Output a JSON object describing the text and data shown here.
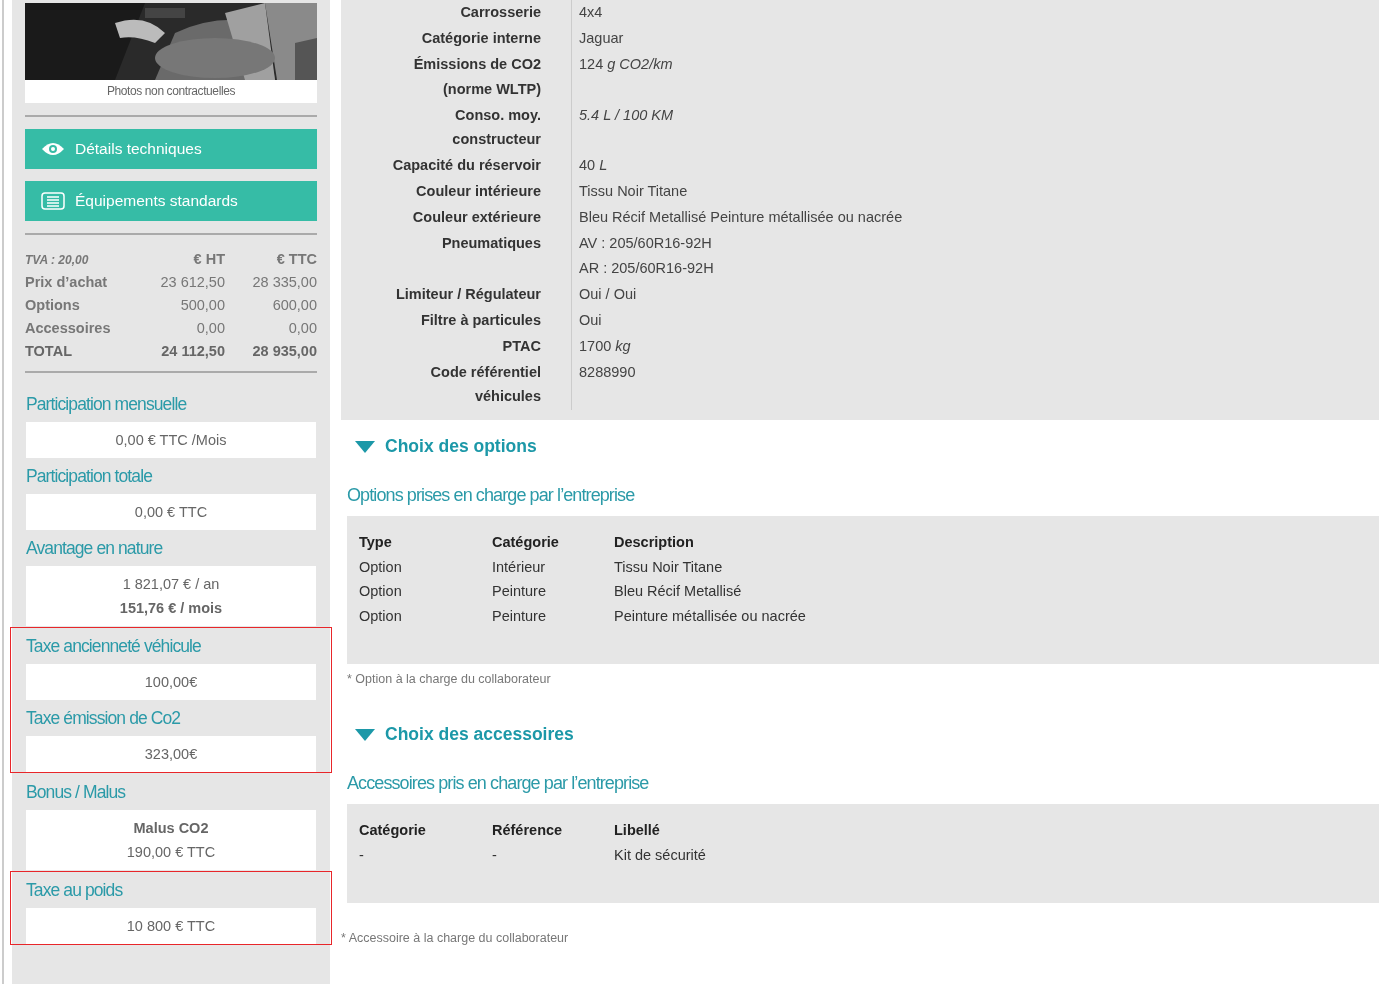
{
  "photo": {
    "kind": "picture",
    "caption": "Photos non contractuelles"
  },
  "actions": [
    {
      "label": "Détails techniques"
    },
    {
      "label": "Équipements standards"
    }
  ],
  "prices": {
    "columns": [
      "TVA : 20,00",
      "€ HT",
      "€ TTC"
    ],
    "rows": [
      {
        "label": "Prix d’achat",
        "ht": "23 612,50",
        "ttc": "28 335,00",
        "total": false
      },
      {
        "label": "Options",
        "ht": "500,00",
        "ttc": "600,00",
        "total": false
      },
      {
        "label": "Accessoires",
        "ht": "0,00",
        "ttc": "0,00",
        "total": false
      },
      {
        "label": "TOTAL",
        "ht": "24 112,50",
        "ttc": "28 935,00",
        "total": true
      }
    ]
  },
  "summary_groups": [
    {
      "highlighted": false,
      "items": [
        {
          "title": "Participation mensuelle",
          "lines": [
            {
              "text": "0,00 € TTC /Mois",
              "bold": false
            }
          ]
        },
        {
          "title": "Participation totale",
          "lines": [
            {
              "text": "0,00 € TTC",
              "bold": false
            }
          ]
        },
        {
          "title": "Avantage en nature",
          "lines": [
            {
              "text": "1 821,07 € / an",
              "bold": false
            },
            {
              "text": "151,76 € / mois",
              "bold": true
            }
          ]
        }
      ]
    },
    {
      "highlighted": true,
      "items": [
        {
          "title": "Taxe ancienneté véhicule",
          "lines": [
            {
              "text": "100,00€",
              "bold": false
            }
          ]
        },
        {
          "title": "Taxe émission de Co2",
          "lines": [
            {
              "text": "323,00€",
              "bold": false
            }
          ]
        }
      ]
    },
    {
      "highlighted": false,
      "items": [
        {
          "title": "Bonus / Malus",
          "lines": [
            {
              "text": "Malus CO2",
              "bold": true
            },
            {
              "text": "190,00 € TTC",
              "bold": false
            }
          ]
        }
      ]
    },
    {
      "highlighted": true,
      "items": [
        {
          "title": "Taxe au poids",
          "lines": [
            {
              "text": "10 800 € TTC",
              "bold": false
            }
          ]
        }
      ]
    }
  ],
  "specs": [
    {
      "label": "Carrosserie",
      "values": [
        "4x4"
      ]
    },
    {
      "label": "Catégorie interne",
      "values": [
        "Jaguar"
      ]
    },
    {
      "label": "Émissions de CO2 (norme WLTP)",
      "values": [
        "124 *g CO2/km*"
      ]
    },
    {
      "label": "Conso. moy. constructeur",
      "values": [
        "*5.4 L / 100 KM*"
      ]
    },
    {
      "label": "Capacité du réservoir",
      "values": [
        "40 *L*"
      ]
    },
    {
      "label": "Couleur intérieure",
      "values": [
        "Tissu Noir Titane"
      ]
    },
    {
      "label": "Couleur extérieure",
      "values": [
        "Bleu Récif Metallisé Peinture métallisée ou nacrée"
      ]
    },
    {
      "label": "Pneumatiques",
      "values": [
        "AV : 205/60R16-92H",
        "AR : 205/60R16-92H"
      ]
    },
    {
      "label": "Limiteur / Régulateur",
      "values": [
        "Oui / Oui"
      ]
    },
    {
      "label": "Filtre à particules",
      "values": [
        "Oui"
      ]
    },
    {
      "label": "PTAC",
      "values": [
        "1700 *kg*"
      ]
    },
    {
      "label": "Code référentiel véhicules",
      "values": [
        "8288990"
      ]
    }
  ],
  "sections": [
    {
      "title": "Choix des options",
      "expanded": true,
      "subtitle": "Options prises en charge par l’entreprise",
      "columns": [
        "Type",
        "Catégorie",
        "Description"
      ],
      "rows": [
        [
          "Option",
          "Intérieur",
          "Tissu Noir Titane"
        ],
        [
          "Option",
          "Peinture",
          "Bleu Récif Metallisé"
        ],
        [
          "Option",
          "Peinture",
          "Peinture métallisée ou nacrée"
        ]
      ],
      "footnote": "* Option à la charge du collaborateur"
    },
    {
      "title": "Choix des accessoires",
      "expanded": true,
      "subtitle": "Accessoires pris en charge par l’entreprise",
      "columns": [
        "Catégorie",
        "Référence",
        "Libellé"
      ],
      "rows": [
        [
          "-",
          "-",
          "Kit de sécurité"
        ]
      ],
      "footnote": "* Accessoire à la charge du collaborateur"
    }
  ]
}
